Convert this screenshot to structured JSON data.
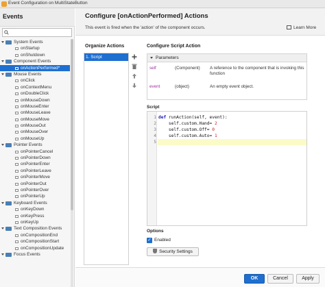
{
  "window": {
    "title": "Event Configuration on MultiStateButton"
  },
  "events_panel": {
    "header": "Events",
    "search_placeholder": "",
    "tree": [
      {
        "kind": "cat",
        "label": "System Events"
      },
      {
        "kind": "leaf",
        "label": "onStartup"
      },
      {
        "kind": "leaf",
        "label": "onShutdown"
      },
      {
        "kind": "cat",
        "label": "Component Events"
      },
      {
        "kind": "leaf",
        "label": "onActionPerformed*",
        "selected": true
      },
      {
        "kind": "cat",
        "label": "Mouse Events"
      },
      {
        "kind": "leaf",
        "label": "onClick"
      },
      {
        "kind": "leaf",
        "label": "onContextMenu"
      },
      {
        "kind": "leaf",
        "label": "onDoubleClick"
      },
      {
        "kind": "leaf",
        "label": "onMouseDown"
      },
      {
        "kind": "leaf",
        "label": "onMouseEnter"
      },
      {
        "kind": "leaf",
        "label": "onMouseLeave"
      },
      {
        "kind": "leaf",
        "label": "onMouseMove"
      },
      {
        "kind": "leaf",
        "label": "onMouseOut"
      },
      {
        "kind": "leaf",
        "label": "onMouseOver"
      },
      {
        "kind": "leaf",
        "label": "onMouseUp"
      },
      {
        "kind": "cat",
        "label": "Pointer Events"
      },
      {
        "kind": "leaf",
        "label": "onPointerCancel"
      },
      {
        "kind": "leaf",
        "label": "onPointerDown"
      },
      {
        "kind": "leaf",
        "label": "onPointerEnter"
      },
      {
        "kind": "leaf",
        "label": "onPointerLeave"
      },
      {
        "kind": "leaf",
        "label": "onPointerMove"
      },
      {
        "kind": "leaf",
        "label": "onPointerOut"
      },
      {
        "kind": "leaf",
        "label": "onPointerOver"
      },
      {
        "kind": "leaf",
        "label": "onPointerUp"
      },
      {
        "kind": "cat",
        "label": "Keyboard Events"
      },
      {
        "kind": "leaf",
        "label": "onKeyDown"
      },
      {
        "kind": "leaf",
        "label": "onKeyPress"
      },
      {
        "kind": "leaf",
        "label": "onKeyUp"
      },
      {
        "kind": "cat",
        "label": "Text Composition Events"
      },
      {
        "kind": "leaf",
        "label": "onCompositionEnd"
      },
      {
        "kind": "leaf",
        "label": "onCompositionStart"
      },
      {
        "kind": "leaf",
        "label": "onCompositionUpdate"
      },
      {
        "kind": "cat",
        "label": "Focus Events"
      }
    ]
  },
  "main": {
    "title": "Configure [onActionPerformed] Actions",
    "subtitle": "This event is fired when the 'action' of the component occurs.",
    "learn_more": "Learn More",
    "organize_label": "Organize Actions",
    "actions": [
      "1. Script"
    ],
    "configure_label": "Configure Script Action",
    "parameters": {
      "header": "Parameters",
      "rows": [
        {
          "name": "self",
          "type": "(Component)",
          "desc": "A reference to the component that is invoking this function"
        },
        {
          "name": "event",
          "type": "(object)",
          "desc": "An empty event object."
        }
      ]
    },
    "script_label": "Script",
    "script": {
      "line_numbers": [
        "1",
        "2",
        "3",
        "4",
        "5"
      ],
      "def_kw": "def",
      "line1_rest": " runAction(self, event):",
      "line2_code": "    self.custom.Hand= ",
      "line2_num": "2",
      "line3_code": "    self.custom.Off= ",
      "line3_num": "0",
      "line4_code": "    self.custom.Auto= ",
      "line4_num": "1",
      "line5": "    "
    },
    "options_label": "Options",
    "enabled_label": "Enabled",
    "enabled_checked": true,
    "security_button": "Security Settings",
    "buttons": {
      "ok": "OK",
      "cancel": "Cancel",
      "apply": "Apply"
    }
  }
}
